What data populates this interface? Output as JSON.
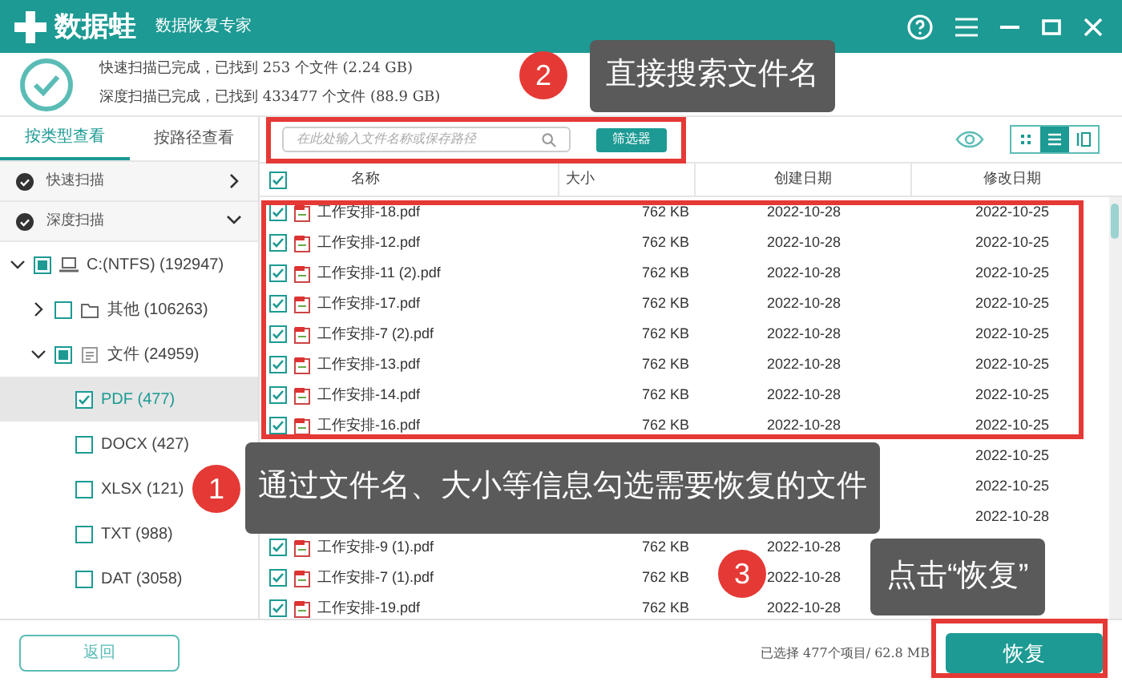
{
  "window": {
    "title": "数据蛙",
    "subtitle": "数据恢复专家"
  },
  "scan_status": [
    "快速扫描已完成，已找到 253 个文件 (2.24 GB)",
    "深度扫描已完成，已找到 433477 个文件 (88.9 GB)"
  ],
  "view_tabs": [
    {
      "label": "按类型查看",
      "selected": true
    },
    {
      "label": "按路径查看",
      "selected": false
    }
  ],
  "scan_groups": [
    {
      "label": "快速扫描",
      "expanded": false
    },
    {
      "label": "深度扫描",
      "expanded": true
    }
  ],
  "tree": [
    {
      "label": "C:(NTFS) (192947)",
      "kind": "drive",
      "checked": false,
      "partial": true,
      "expanded": true,
      "selected": false,
      "children": [
        {
          "label": "其他 (106263)",
          "kind": "folder",
          "checked": false,
          "partial": false,
          "expanded": false,
          "selected": false
        },
        {
          "label": "文件 (24959)",
          "kind": "document",
          "checked": false,
          "partial": true,
          "expanded": true,
          "selected": false,
          "children": [
            {
              "label": "PDF (477)",
              "checked": true,
              "partial": false,
              "selected": true
            },
            {
              "label": "DOCX (427)",
              "checked": false,
              "partial": false,
              "selected": false
            },
            {
              "label": "XLSX (121)",
              "checked": false,
              "partial": false,
              "selected": false
            },
            {
              "label": "TXT (988)",
              "checked": false,
              "partial": false,
              "selected": false
            },
            {
              "label": "DAT (3058)",
              "checked": false,
              "partial": false,
              "selected": false
            }
          ]
        }
      ]
    }
  ],
  "search": {
    "placeholder": "在此处输入文件名称或保存路径"
  },
  "filter_button": "筛选器",
  "view_modes": [
    {
      "kind": "grid",
      "selected": false
    },
    {
      "kind": "list",
      "selected": true
    },
    {
      "kind": "detail",
      "selected": false
    }
  ],
  "table": {
    "all_checked": true,
    "columns": [
      "名称",
      "大小",
      "创建日期",
      "修改日期"
    ],
    "rows": [
      {
        "checked": true,
        "name": "工作安排-18.pdf",
        "size": "762 KB",
        "created": "2022-10-28",
        "modified": "2022-10-25"
      },
      {
        "checked": true,
        "name": "工作安排-12.pdf",
        "size": "762 KB",
        "created": "2022-10-28",
        "modified": "2022-10-25"
      },
      {
        "checked": true,
        "name": "工作安排-11 (2).pdf",
        "size": "762 KB",
        "created": "2022-10-28",
        "modified": "2022-10-25"
      },
      {
        "checked": true,
        "name": "工作安排-17.pdf",
        "size": "762 KB",
        "created": "2022-10-28",
        "modified": "2022-10-25"
      },
      {
        "checked": true,
        "name": "工作安排-7 (2).pdf",
        "size": "762 KB",
        "created": "2022-10-28",
        "modified": "2022-10-25"
      },
      {
        "checked": true,
        "name": "工作安排-13.pdf",
        "size": "762 KB",
        "created": "2022-10-28",
        "modified": "2022-10-25"
      },
      {
        "checked": true,
        "name": "工作安排-14.pdf",
        "size": "762 KB",
        "created": "2022-10-28",
        "modified": "2022-10-25"
      },
      {
        "checked": true,
        "name": "工作安排-16.pdf",
        "size": "762 KB",
        "created": "2022-10-28",
        "modified": "2022-10-25"
      },
      {
        "modified": "2022-10-25"
      },
      {
        "modified": "2022-10-25"
      },
      {
        "modified": "2022-10-28"
      },
      {
        "checked": true,
        "name": "工作安排-9 (1).pdf",
        "size": "762 KB",
        "created": "2022-10-28"
      },
      {
        "checked": true,
        "name": "工作安排-7 (1).pdf",
        "size": "762 KB",
        "created": "2022-10-28"
      },
      {
        "checked": true,
        "name": "工作安排-19.pdf",
        "size": "762 KB",
        "created": "2022-10-28"
      }
    ]
  },
  "footer": {
    "back_button": "返回",
    "selection": "已选择 477个项目/ 62.8 MB",
    "recover_button": "恢复"
  },
  "callouts": [
    {
      "number": "2",
      "text": "直接搜索文件名"
    },
    {
      "number": "1",
      "text": "通过文件名、大小等信息勾选需要恢复的文件"
    },
    {
      "number": "3",
      "text": "点击“恢复”"
    }
  ]
}
